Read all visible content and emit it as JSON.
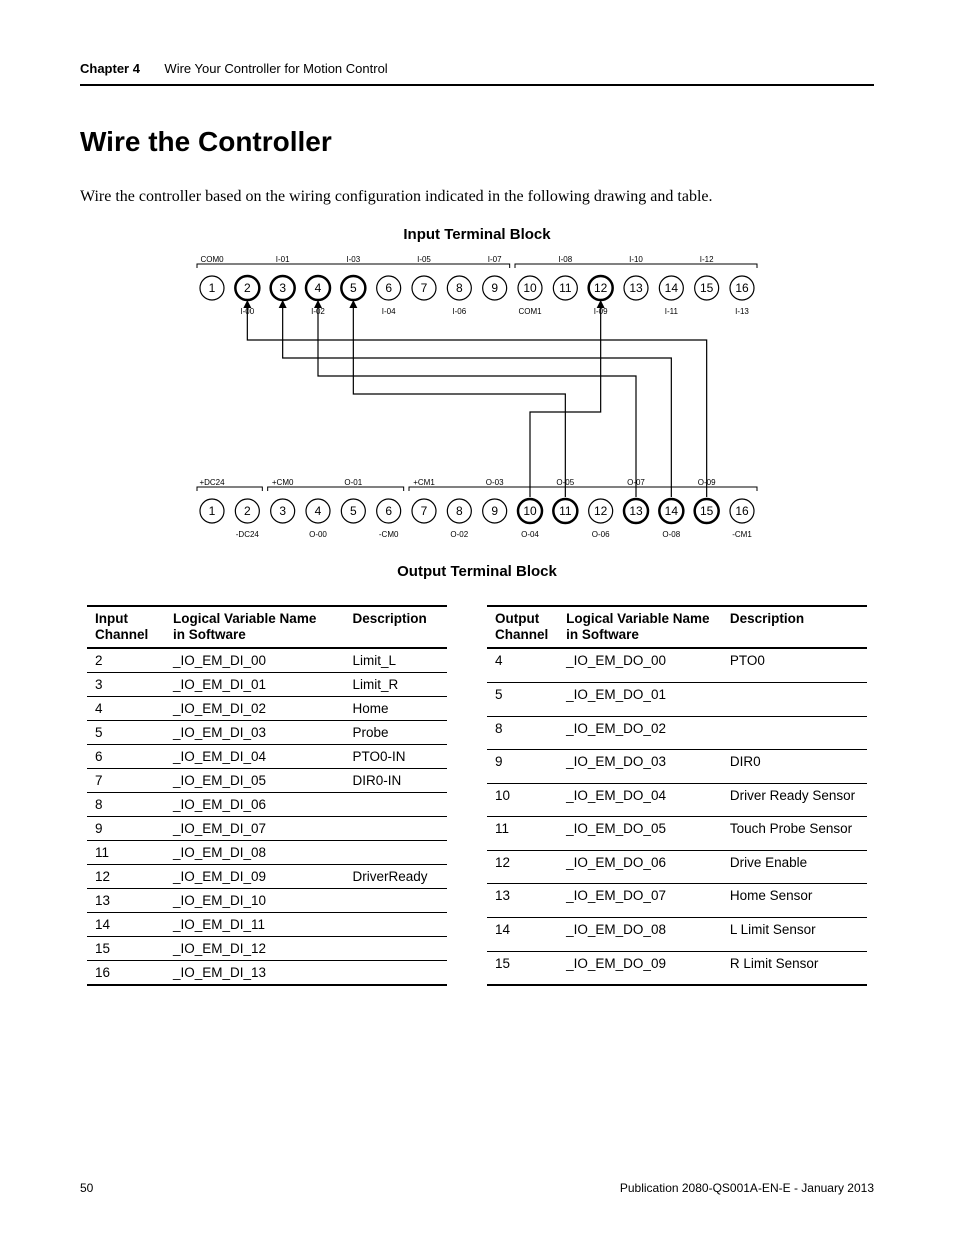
{
  "header": {
    "chapter_label": "Chapter 4",
    "chapter_title": "Wire Your Controller for Motion Control"
  },
  "section_title": "Wire the Controller",
  "intro_text": "Wire the controller based on the wiring configuration indicated in the following drawing and table.",
  "diagram": {
    "input_title": "Input Terminal Block",
    "output_title": "Output Terminal Block",
    "input_top_labels": [
      "COM0",
      "",
      "I-01",
      "",
      "I-03",
      "",
      "I-05",
      "",
      "I-07",
      "",
      "I-08",
      "",
      "I-10",
      "",
      "I-12",
      ""
    ],
    "input_bottom_labels": [
      "",
      "I-00",
      "",
      "I-02",
      "",
      "I-04",
      "",
      "I-06",
      "",
      "COM1",
      "",
      "I-09",
      "",
      "I-11",
      "",
      "I-13"
    ],
    "output_top_labels": [
      "+DC24",
      "",
      "+CM0",
      "",
      "O-01",
      "",
      "+CM1",
      "",
      "O-03",
      "",
      "O-05",
      "",
      "O-07",
      "",
      "O-09",
      ""
    ],
    "output_bottom_labels": [
      "",
      "-DC24",
      "",
      "O-00",
      "",
      "-CM0",
      "",
      "O-02",
      "",
      "O-04",
      "",
      "O-06",
      "",
      "O-08",
      "",
      "-CM1"
    ],
    "wiring_pairs": [
      [
        2,
        15
      ],
      [
        3,
        14
      ],
      [
        4,
        13
      ],
      [
        5,
        11
      ],
      [
        12,
        10
      ]
    ]
  },
  "input_table": {
    "headers": [
      "Input Channel",
      "Logical Variable Name in Software",
      "Description"
    ],
    "rows": [
      [
        "2",
        "_IO_EM_DI_00",
        "Limit_L"
      ],
      [
        "3",
        "_IO_EM_DI_01",
        "Limit_R"
      ],
      [
        "4",
        "_IO_EM_DI_02",
        "Home"
      ],
      [
        "5",
        "_IO_EM_DI_03",
        "Probe"
      ],
      [
        "6",
        "_IO_EM_DI_04",
        "PTO0-IN"
      ],
      [
        "7",
        "_IO_EM_DI_05",
        "DIR0-IN"
      ],
      [
        "8",
        "_IO_EM_DI_06",
        ""
      ],
      [
        "9",
        "_IO_EM_DI_07",
        ""
      ],
      [
        "11",
        "_IO_EM_DI_08",
        ""
      ],
      [
        "12",
        "_IO_EM_DI_09",
        "DriverReady"
      ],
      [
        "13",
        "_IO_EM_DI_10",
        ""
      ],
      [
        "14",
        "_IO_EM_DI_11",
        ""
      ],
      [
        "15",
        "_IO_EM_DI_12",
        ""
      ],
      [
        "16",
        "_IO_EM_DI_13",
        ""
      ]
    ]
  },
  "output_table": {
    "headers": [
      "Output Channel",
      "Logical Variable Name in Software",
      "Description"
    ],
    "rows": [
      [
        "4",
        "_IO_EM_DO_00",
        "PTO0"
      ],
      [
        "5",
        "_IO_EM_DO_01",
        ""
      ],
      [
        "8",
        "_IO_EM_DO_02",
        ""
      ],
      [
        "9",
        "_IO_EM_DO_03",
        "DIR0"
      ],
      [
        "10",
        "_IO_EM_DO_04",
        "Driver Ready Sensor"
      ],
      [
        "11",
        "_IO_EM_DO_05",
        "Touch Probe Sensor"
      ],
      [
        "12",
        "_IO_EM_DO_06",
        "Drive Enable"
      ],
      [
        "13",
        "_IO_EM_DO_07",
        "Home Sensor"
      ],
      [
        "14",
        "_IO_EM_DO_08",
        "L Limit Sensor"
      ],
      [
        "15",
        "_IO_EM_DO_09",
        "R Limit Sensor"
      ]
    ]
  },
  "footer": {
    "page_number": "50",
    "publication": "Publication 2080-QS001A-EN-E - January 2013"
  }
}
